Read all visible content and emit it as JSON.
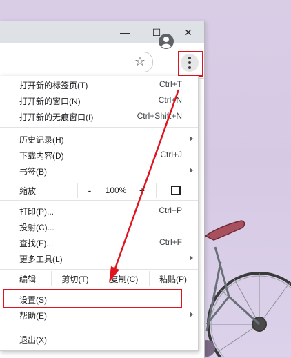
{
  "window_controls": {
    "minimize": "—",
    "maximize": "☐",
    "close": "✕"
  },
  "toolbar": {
    "star_icon": "☆"
  },
  "menu": {
    "new_tab": {
      "label": "打开新的标签页(T)",
      "shortcut": "Ctrl+T"
    },
    "new_window": {
      "label": "打开新的窗口(N)",
      "shortcut": "Ctrl+N"
    },
    "new_incognito": {
      "label": "打开新的无痕窗口(I)",
      "shortcut": "Ctrl+Shift+N"
    },
    "history": {
      "label": "历史记录(H)"
    },
    "downloads": {
      "label": "下载内容(D)",
      "shortcut": "Ctrl+J"
    },
    "bookmarks": {
      "label": "书签(B)"
    },
    "zoom": {
      "label": "缩放",
      "minus": "-",
      "value": "100%",
      "plus": "+"
    },
    "print": {
      "label": "打印(P)...",
      "shortcut": "Ctrl+P"
    },
    "cast": {
      "label": "投射(C)..."
    },
    "find": {
      "label": "查找(F)...",
      "shortcut": "Ctrl+F"
    },
    "more_tools": {
      "label": "更多工具(L)"
    },
    "edit": {
      "label": "编辑",
      "cut": "剪切(T)",
      "copy": "复制(C)",
      "paste": "粘贴(P)"
    },
    "settings": {
      "label": "设置(S)"
    },
    "help": {
      "label": "帮助(E)"
    },
    "exit": {
      "label": "退出(X)"
    }
  },
  "colors": {
    "highlight": "#e0141e",
    "arrow": "#e0141e"
  }
}
